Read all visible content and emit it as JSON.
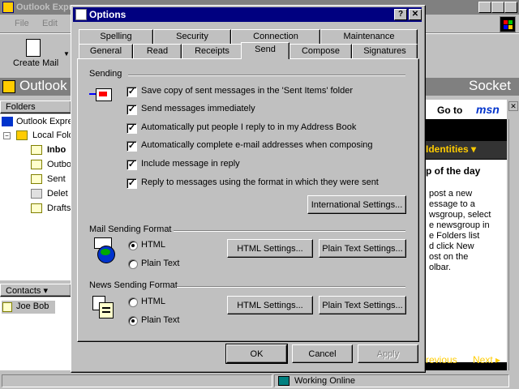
{
  "main_window": {
    "title": "Outlook Expr",
    "menu": [
      "File",
      "Edit"
    ],
    "toolbar": {
      "create_mail": "Create Mail"
    },
    "folder_bar": {
      "left_title": "Outlook",
      "right_title": "Socket"
    },
    "folders_header": "Folders",
    "folders": [
      {
        "label": "Outlook Expre",
        "bold": false
      },
      {
        "label": "Local Folde",
        "bold": false
      },
      {
        "label": "Inbo",
        "bold": true
      },
      {
        "label": "Outbo",
        "bold": false
      },
      {
        "label": "Sent",
        "bold": false
      },
      {
        "label": "Delet",
        "bold": false
      },
      {
        "label": "Drafts",
        "bold": false
      }
    ],
    "contacts_header": "Contacts ▾",
    "contacts": [
      "Joe Bob"
    ],
    "right_pane": {
      "goto_text": "Go to",
      "msn_text": "msn",
      "identities": "Identities ▾",
      "tip_title": "p of the day",
      "tip_lines": [
        "post a new",
        "essage to a",
        "wsgroup, select",
        "e newsgroup in",
        "e Folders list",
        "d click New",
        "ost on the",
        "olbar."
      ],
      "previous": "revious",
      "next": "Next ▸"
    },
    "status": {
      "online": "Working Online"
    },
    "colors": {
      "accent_yellow": "#ffcc00",
      "msn_blue": "#0033cc",
      "title_active": "#000080",
      "title_inactive": "#808080"
    }
  },
  "dialog": {
    "title": "Options",
    "help_button": "?",
    "close_button": "✕",
    "tabs_back": [
      "Spelling",
      "Security",
      "Connection",
      "Maintenance"
    ],
    "tabs_front": [
      "General",
      "Read",
      "Receipts",
      "Send",
      "Compose",
      "Signatures"
    ],
    "active_tab": "Send",
    "sending": {
      "label": "Sending",
      "options": [
        {
          "label": "Save copy of sent messages in the 'Sent Items' folder",
          "checked": true
        },
        {
          "label": "Send messages immediately",
          "checked": true
        },
        {
          "label": "Automatically put people I reply to in my Address Book",
          "checked": true
        },
        {
          "label": "Automatically complete e-mail addresses when composing",
          "checked": true
        },
        {
          "label": "Include message in reply",
          "checked": true
        },
        {
          "label": "Reply to messages using the format in which they were sent",
          "checked": true
        }
      ],
      "international_button": "International Settings..."
    },
    "mail_format": {
      "label": "Mail Sending Format",
      "html": "HTML",
      "plain": "Plain Text",
      "selected": "HTML",
      "html_settings": "HTML Settings...",
      "plain_settings": "Plain Text Settings..."
    },
    "news_format": {
      "label": "News Sending Format",
      "html": "HTML",
      "plain": "Plain Text",
      "selected": "Plain Text",
      "html_settings": "HTML Settings...",
      "plain_settings": "Plain Text Settings..."
    },
    "buttons": {
      "ok": "OK",
      "cancel": "Cancel",
      "apply": "Apply"
    }
  }
}
